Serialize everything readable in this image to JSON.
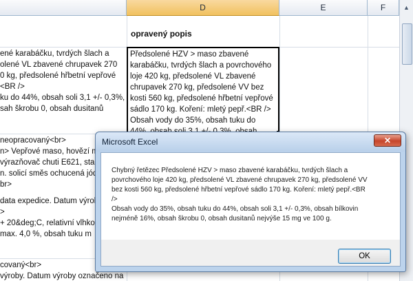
{
  "sheet": {
    "columns": [
      "D",
      "E",
      "F"
    ],
    "d_title": "opravený popis",
    "left_lines_row1": [
      "ené karabáčku, tvrdých šlach a",
      "olené VL zbavené chrupavek 270",
      "0 kg, předsolené hřbetní vepřové",
      "<BR />",
      "ku do 44%, obsah soli 3,1 +/- 0,3%,",
      "sah škrobu 0, obsah dusitanů"
    ],
    "left_lines_row2": [
      "neopracovaný<br>",
      "n> Vepřové maso, hovězí m",
      "výrazňovač chuti E621, sta",
      "n. solicí směs ochucená jód",
      "br>",
      "",
      "data expedice. Datum výrob",
      ">",
      "+ 20&deg;C, relativní vlhkos",
      "max. 4,0 %, obsah tuku m"
    ],
    "left_lines_row3": [
      "covaný<br>",
      "výroby. Datum výroby označeno na"
    ],
    "active_cell_lines": [
      "Předsolené HZV > maso zbavené",
      "karabáčku, tvrdých šlach a povrchového",
      "loje 420 kg, předsolené VL zbavené",
      "chrupavek 270 kg, předsolené VV bez",
      "kosti 560 kg, předsolené hřbetní vepřové",
      "sádlo 170 kg. Koření: mletý pepř.<BR />",
      "Obsah vody do 35%, obsah tuku do",
      "44%, obsah soli 3,1 +/- 0,3%, obsah"
    ]
  },
  "dialog": {
    "title": "Microsoft Excel",
    "close_label": "✕",
    "message_lines": [
      "Chybný řetězec Předsolené HZV > maso zbavené karabáčku, tvrdých šlach a",
      "povrchového loje 420 kg, předsolené VL zbavené chrupavek 270 kg, předsolené VV",
      "bez kosti 560 kg, předsolené hřbetní vepřové sádlo 170 kg. Koření: mletý pepř.<BR",
      "/>",
      "Obsah vody do 35%, obsah tuku do 44%, obsah soli 3,1 +/- 0,3%, obsah bílkovin",
      "nejméně 16%, obsah škrobu 0, obsah dusitanů nejvýše 15 mg ve 100 g."
    ],
    "ok_label": "OK"
  },
  "colors": {
    "header_selected": "#f1c15f",
    "dialog_frame": "#bcd3ec",
    "close_button": "#c6452b"
  }
}
